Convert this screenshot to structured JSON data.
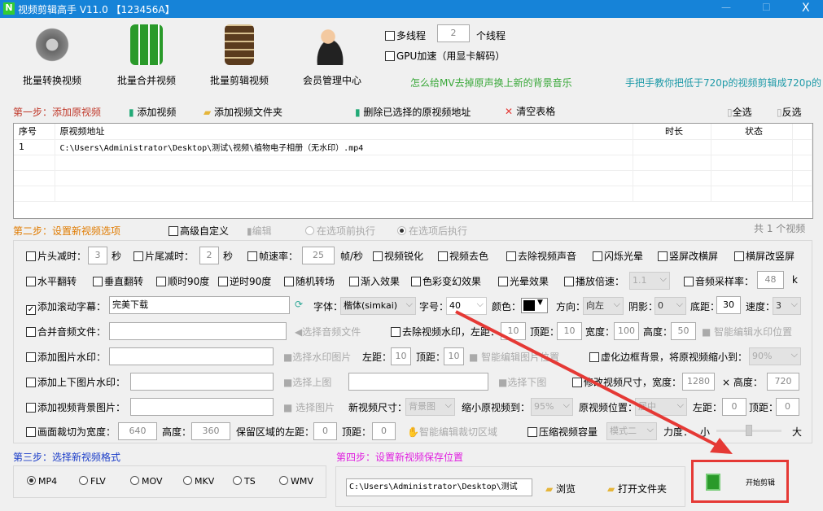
{
  "window": {
    "title": "视频剪辑高手 V11.0 【123456A】",
    "minimize": "—",
    "maximize": "☐",
    "close": "X"
  },
  "toolbar": {
    "buttons": [
      {
        "label": "批量转换视频"
      },
      {
        "label": "批量合并视频"
      },
      {
        "label": "批量剪辑视频"
      },
      {
        "label": "会员管理中心"
      }
    ],
    "multithread_label": "多线程",
    "threads": "2",
    "threads_unit": "个线程",
    "gpu_label": "GPU加速（用显卡解码）",
    "link1": "怎么给MV去掉原声换上新的背景音乐",
    "link2": "手把手教你把低于720p的视频剪辑成720p的"
  },
  "step1": {
    "title": "第一步：添加原视频",
    "add_video": "添加视频",
    "add_folder": "添加视频文件夹",
    "delete_selected": "删除已选择的原视频地址",
    "clear_table": "清空表格",
    "select_all": "全选",
    "invert": "反选"
  },
  "table": {
    "headers": [
      "序号",
      "原视频地址",
      "时长",
      "状态"
    ],
    "rows": [
      {
        "index": "1",
        "path": "C:\\Users\\Administrator\\Desktop\\测试\\视频\\植物电子相册（无水印）.mp4",
        "duration": "",
        "status": ""
      }
    ]
  },
  "step2": {
    "title": "第二步：设置新视频选项",
    "advanced": "高级自定义",
    "edit": "编辑",
    "before": "在选项前执行",
    "after": "在选项后执行",
    "count": "共 1 个视频"
  },
  "options": {
    "head_cut": "片头减时：",
    "head_val": "3",
    "sec": "秒",
    "tail_cut": "片尾减时：",
    "tail_val": "2",
    "fps": "帧速率：",
    "fps_val": "25",
    "fps_unit": "帧/秒",
    "sharpen": "视频锐化",
    "decolor": "视频去色",
    "remove_audio": "去除视频声音",
    "flash": "闪烁光晕",
    "v2h": "竖屏改横屏",
    "h2v": "横屏改竖屏",
    "hflip": "水平翻转",
    "vflip": "垂直翻转",
    "cw90": "顺时90度",
    "ccw90": "逆时90度",
    "random_trans": "随机转场",
    "fadein": "渐入效果",
    "color_fx": "色彩变幻效果",
    "halo": "光晕效果",
    "speed": "播放倍速：",
    "speed_val": "1.1",
    "sample_rate": "音频采样率：",
    "sample_val": "48",
    "sample_unit": "k",
    "scroll_text": "添加滚动字幕：",
    "scroll_val": "完美下载",
    "font": "字体：",
    "font_val": "楷体(simkai)",
    "size": "字号：",
    "size_val": "40",
    "color": "颜色：",
    "direction": "方向：",
    "direction_val": "向左",
    "shadow": "阴影：",
    "shadow_val": "0",
    "bottom": "底距：",
    "bottom_val": "30",
    "speed2": "速度：",
    "speed2_val": "3",
    "merge_audio": "合并音频文件：",
    "choose_audio": "选择音频文件",
    "remove_wm": "去除视频水印，左距：",
    "wm_left": "10",
    "top": "顶距：",
    "wm_top": "10",
    "width": "宽度：",
    "wm_width": "100",
    "height": "高度：",
    "wm_height": "50",
    "smart_wm": "智能编辑水印位置",
    "img_wm": "添加图片水印：",
    "choose_wm_img": "选择水印图片",
    "left": "左距：",
    "img_left": "10",
    "img_top": "10",
    "smart_img": "智能编辑图片位置",
    "blur_bg": "虚化边框背景，将原视频缩小到：",
    "blur_val": "90%",
    "tb_wm": "添加上下图片水印：",
    "choose_top": "选择上图",
    "choose_bottom": "选择下图",
    "resize": "修改视频尺寸，宽度：",
    "resize_w": "1280",
    "times_height": "× 高度：",
    "resize_h": "720",
    "bg_img": "添加视频背景图片：",
    "choose_img": "选择图片",
    "new_size": "新视频尺寸：",
    "new_size_val": "背景图",
    "shrink": "缩小原视频到：",
    "shrink_val": "95%",
    "pos": "原视频位置：",
    "pos_val": "居中",
    "bg_left": "0",
    "bg_top": "0",
    "crop": "画面裁切为宽度：",
    "crop_w": "640",
    "crop_h": "360",
    "keep_left": "保留区域的左距：",
    "crop_left": "0",
    "crop_top": "0",
    "smart_crop": "智能编辑裁切区域",
    "compress": "压缩视频容量",
    "compress_val": "模式二",
    "strength": "力度：",
    "small": "小",
    "large": "大"
  },
  "step3": {
    "title": "第三步：选择新视频格式",
    "formats": [
      "MP4",
      "FLV",
      "MOV",
      "MKV",
      "TS",
      "WMV"
    ],
    "selected": "MP4"
  },
  "step4": {
    "title": "第四步：设置新视频保存位置",
    "path": "C:\\Users\\Administrator\\Desktop\\测试\\视",
    "browse": "浏览",
    "open_folder": "打开文件夹"
  },
  "start": {
    "label": "开始剪辑"
  },
  "colors": {
    "titlebar": "#1683d8",
    "step1": "#c0392b",
    "step2": "#e07b00",
    "step3": "#1a3cc8",
    "step4": "#e020e0",
    "link1": "#3aa83a",
    "link2": "#1e9aa8",
    "highlight": "#e53935"
  }
}
